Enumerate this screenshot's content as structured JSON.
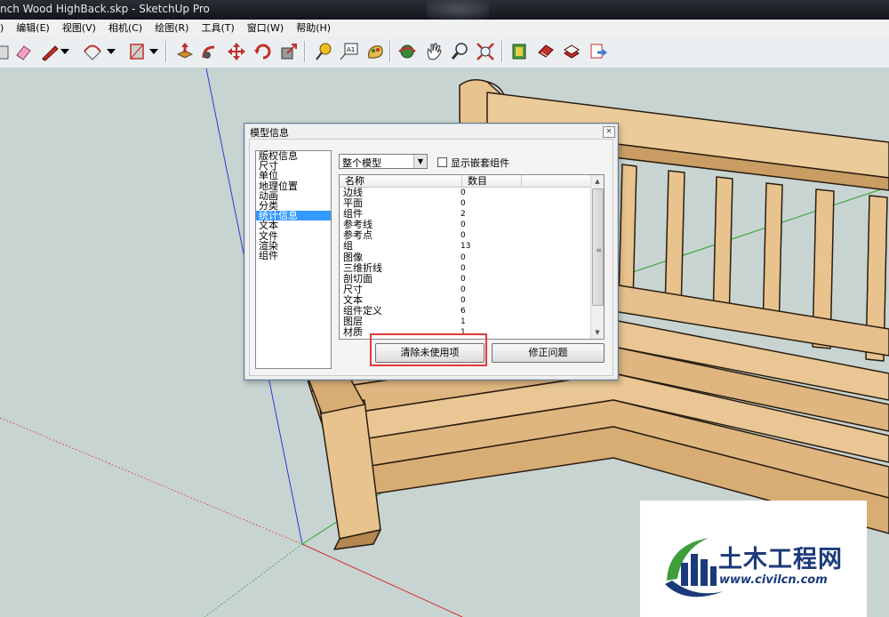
{
  "window": {
    "title": "nch Wood HighBack.skp - SketchUp Pro"
  },
  "menu": [
    ")",
    "编辑(E)",
    "视图(V)",
    "相机(C)",
    "绘图(R)",
    "工具(T)",
    "窗口(W)",
    "帮助(H)"
  ],
  "toolbar": {
    "tools": [
      "paint-bucket-icon",
      "eraser-icon",
      "pencil-icon",
      "dropdown-icon",
      "arc-icon",
      "dropdown-icon",
      "rectangle-icon",
      "dropdown-icon",
      "push-pull-icon",
      "follow-me-icon",
      "move-icon",
      "rotate-icon",
      "scale-icon",
      "tape-measure-icon",
      "text-icon",
      "paint-icon",
      "orbit-icon",
      "pan-icon",
      "zoom-icon",
      "zoom-extents-icon",
      "components-icon",
      "section-icon",
      "layers-icon",
      "export-icon"
    ]
  },
  "dialog": {
    "title": "模型信息",
    "nav": [
      "版权信息",
      "尺寸",
      "单位",
      "地理位置",
      "动画",
      "分类",
      "统计信息",
      "文本",
      "文件",
      "渲染",
      "组件"
    ],
    "selected_nav": "统计信息",
    "scope_select": "整个模型",
    "show_nested_label": "显示嵌套组件",
    "columns": {
      "name": "名称",
      "count": "数目"
    },
    "rows": [
      {
        "name": "边线",
        "count": "0"
      },
      {
        "name": "平面",
        "count": "0"
      },
      {
        "name": "组件",
        "count": "2"
      },
      {
        "name": "参考线",
        "count": "0"
      },
      {
        "name": "参考点",
        "count": "0"
      },
      {
        "name": "组",
        "count": "13"
      },
      {
        "name": "图像",
        "count": "0"
      },
      {
        "name": "三维折线",
        "count": "0"
      },
      {
        "name": "剖切面",
        "count": "0"
      },
      {
        "name": "尺寸",
        "count": "0"
      },
      {
        "name": "文本",
        "count": "0"
      },
      {
        "name": "组件定义",
        "count": "6"
      },
      {
        "name": "图层",
        "count": "1"
      },
      {
        "name": "材质",
        "count": "1"
      }
    ],
    "purge_button": "清除未使用项",
    "fix_button": "修正问题"
  },
  "watermark": {
    "cn": "土木工程网",
    "url": "www.civilcn.com"
  },
  "colors": {
    "highlight": "#e23a3a",
    "selection": "#3399ff",
    "wood": "#e8c38e",
    "brand": "#1b3a7a"
  }
}
